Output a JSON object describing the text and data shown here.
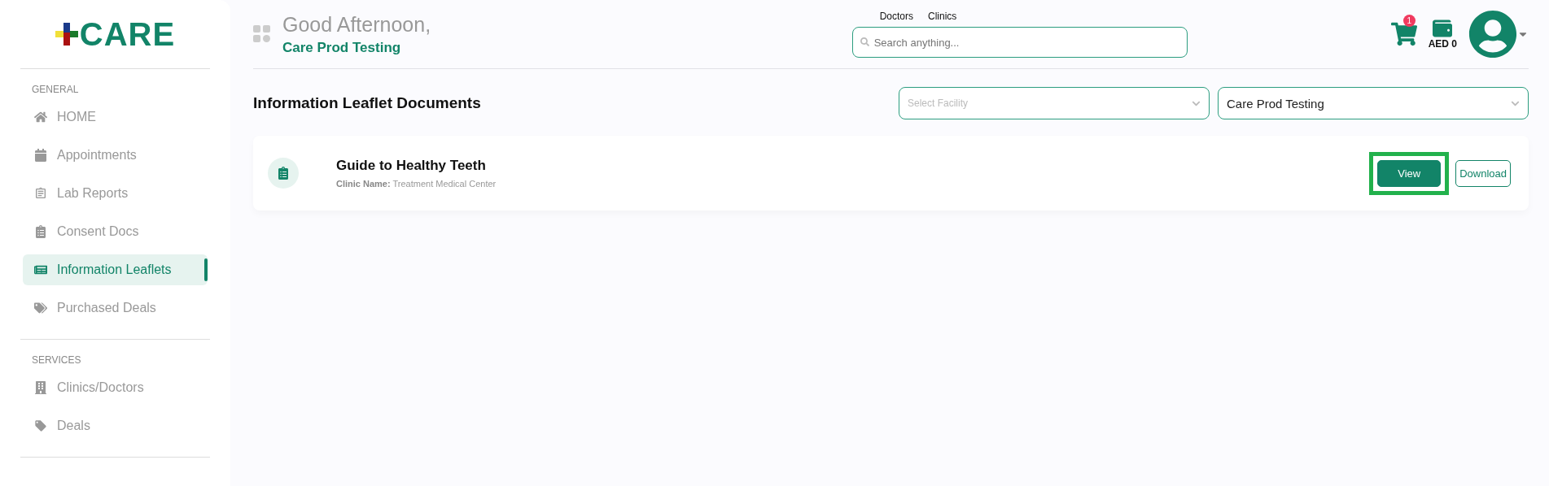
{
  "logo": {
    "text": "CARE"
  },
  "sidebar": {
    "sections": [
      {
        "heading": "GENERAL",
        "items": [
          {
            "label": "HOME",
            "selected": false
          },
          {
            "label": "Appointments",
            "selected": false
          },
          {
            "label": "Lab Reports",
            "selected": false
          },
          {
            "label": "Consent Docs",
            "selected": false
          },
          {
            "label": "Information Leaflets",
            "selected": true
          },
          {
            "label": "Purchased Deals",
            "selected": false
          }
        ]
      },
      {
        "heading": "SERVICES",
        "items": [
          {
            "label": "Clinics/Doctors",
            "selected": false
          },
          {
            "label": "Deals",
            "selected": false
          }
        ]
      }
    ]
  },
  "header": {
    "greeting": "Good Afternoon,",
    "user_name": "Care Prod Testing",
    "search_tabs": [
      {
        "label": "Doctors"
      },
      {
        "label": "Clinics"
      }
    ],
    "search": {
      "placeholder": "Search anything..."
    },
    "cart_count": "1",
    "wallet": "AED 0"
  },
  "page": {
    "title": "Information Leaflet Documents",
    "filters": [
      {
        "placeholder": "Select Facility"
      },
      {
        "value": "Care Prod Testing"
      }
    ],
    "documents": [
      {
        "title": "Guide to Healthy Teeth",
        "clinic_label": "Clinic Name:",
        "clinic": "Treatment Medical Center",
        "actions": [
          {
            "label": "View",
            "kind": "primary",
            "highlighted": true
          },
          {
            "label": "Download",
            "kind": "outline",
            "highlighted": false
          }
        ]
      }
    ]
  }
}
